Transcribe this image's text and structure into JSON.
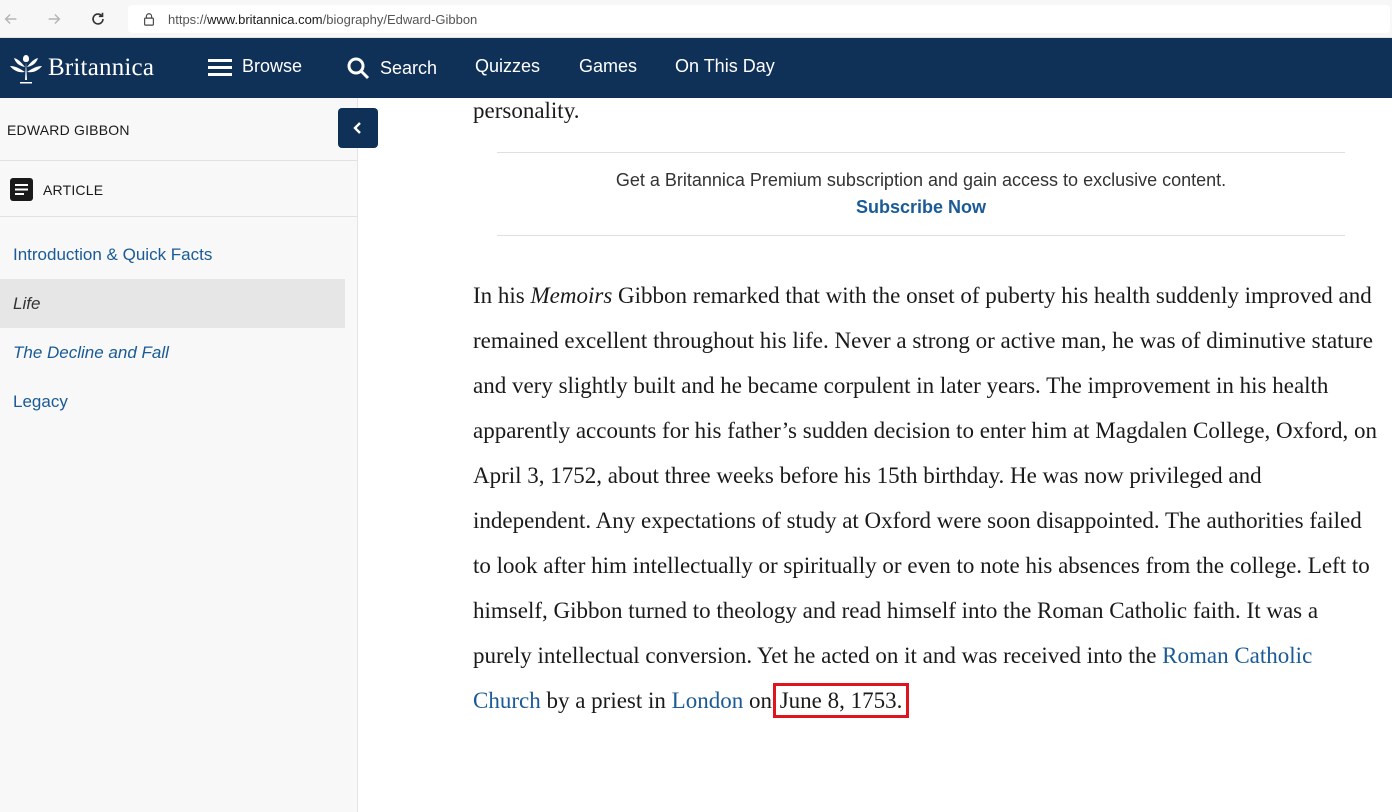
{
  "browser": {
    "url_prefix": "https://",
    "url_host": "www.britannica.com",
    "url_path": "/biography/Edward-Gibbon"
  },
  "header": {
    "logo_text": "Britannica",
    "nav": [
      "Browse",
      "Search",
      "Quizzes",
      "Games",
      "On This Day"
    ],
    "brand_color": "#0f3057"
  },
  "sidebar": {
    "title": "EDWARD GIBBON",
    "article_label": "ARTICLE",
    "toc": [
      {
        "label": "Introduction & Quick Facts",
        "italic": false,
        "active": false
      },
      {
        "label": "Life",
        "italic": true,
        "active": true
      },
      {
        "label": "The Decline and Fall",
        "italic": true,
        "active": false
      },
      {
        "label": "Legacy",
        "italic": false,
        "active": false
      }
    ]
  },
  "article": {
    "lead": "personality.",
    "promo_text": "Get a Britannica Premium subscription and gain access to exclusive content.",
    "promo_link": "Subscribe Now",
    "p_intro": "In his ",
    "p_memoirs": "Memoirs",
    "p_body": " Gibbon remarked that with the onset of puberty his health suddenly improved and remained excellent throughout his life. Never a strong or active man, he was of diminutive stature and very slightly built and he became corpulent in later years. The improvement in his health apparently accounts for his father’s sudden decision to enter him at Magdalen College, Oxford, on April 3, 1752, about three weeks before his 15th birthday. He was now privileged and independent. Any expectations of study at Oxford were soon disappointed. The authorities failed to look after him intellectually or spiritually or even to note his absences from the college. Left to himself, Gibbon turned to theology and read himself into the Roman Catholic faith. It was a purely intellectual conversion. Yet he acted on it and was received into the ",
    "link_church": "Roman Catholic Church",
    "p_mid": " by a priest in ",
    "link_london": "London",
    "p_on": " on ",
    "date": "June 8, 1753."
  }
}
